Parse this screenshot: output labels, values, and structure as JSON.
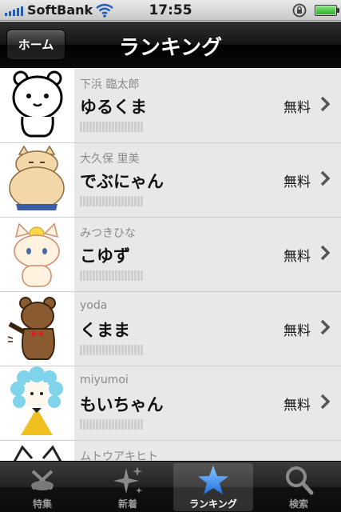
{
  "status_bar": {
    "carrier": "SoftBank",
    "time": "17:55"
  },
  "nav": {
    "title": "ランキング",
    "back_label": "ホーム"
  },
  "rows": [
    {
      "author": "下浜 臨太郎",
      "name": "ゆるくま",
      "price": "無料"
    },
    {
      "author": "大久保 里美",
      "name": "でぶにゃん",
      "price": "無料"
    },
    {
      "author": "みつきひな",
      "name": "こゆず",
      "price": "無料"
    },
    {
      "author": "yoda",
      "name": "くまま",
      "price": "無料"
    },
    {
      "author": "miyumoi",
      "name": "もいちゃん",
      "price": "無料"
    },
    {
      "author": "ムトウアキヒト",
      "name": "",
      "price": ""
    }
  ],
  "tabs": [
    {
      "label": "特集",
      "icon": "scissors-icon"
    },
    {
      "label": "新着",
      "icon": "sparkle-icon"
    },
    {
      "label": "ランキング",
      "icon": "star-icon"
    },
    {
      "label": "検索",
      "icon": "search-icon"
    }
  ],
  "colors": {
    "nav_bg": "#111111",
    "row_bg": "#e8e8e8",
    "active_star": "#3b8ef0"
  }
}
